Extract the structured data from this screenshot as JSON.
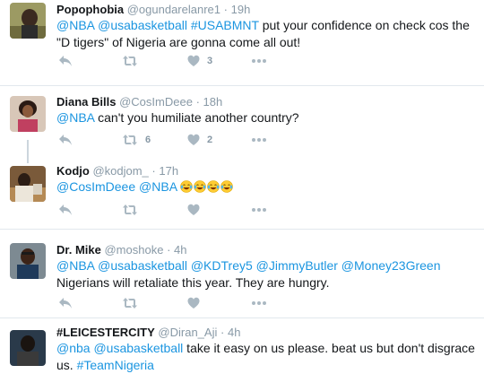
{
  "tweets": [
    {
      "name": "Popophobia",
      "handle": "@ogundarelanre1",
      "dot": "·",
      "time": "19h",
      "text_parts": [
        {
          "t": "@NBA",
          "link": true
        },
        {
          "t": " ",
          "link": false
        },
        {
          "t": "@usabasketball",
          "link": true
        },
        {
          "t": " ",
          "link": false
        },
        {
          "t": "#USABMNT",
          "link": true
        },
        {
          "t": " put your confidence on check cos the \"D tigers\" of Nigeria are gonna come all out!",
          "link": false
        }
      ],
      "actions": {
        "retweets": "",
        "likes": "3"
      }
    },
    {
      "name": "Diana Bills",
      "handle": "@CosImDeee",
      "dot": "·",
      "time": "18h",
      "text_parts": [
        {
          "t": "@NBA",
          "link": true
        },
        {
          "t": " can't you humiliate another country?",
          "link": false
        }
      ],
      "actions": {
        "retweets": "6",
        "likes": "2"
      }
    },
    {
      "name": "Kodjo",
      "handle": "@kodjom_",
      "dot": "·",
      "time": "17h",
      "text_parts": [
        {
          "t": "@CosImDeee",
          "link": true
        },
        {
          "t": " ",
          "link": false
        },
        {
          "t": "@NBA",
          "link": true
        },
        {
          "t": " ",
          "link": false
        }
      ],
      "emoji": [
        "face-with-tears-of-joy",
        "face-with-tears-of-joy",
        "face-with-tears-of-joy",
        "face-with-tears-of-joy"
      ],
      "actions": {
        "retweets": "",
        "likes": ""
      }
    },
    {
      "name": "Dr. Mike",
      "handle": "@moshoke",
      "dot": "·",
      "time": "4h",
      "text_parts": [
        {
          "t": "@NBA",
          "link": true
        },
        {
          "t": " ",
          "link": false
        },
        {
          "t": "@usabasketball",
          "link": true
        },
        {
          "t": " ",
          "link": false
        },
        {
          "t": "@KDTrey5",
          "link": true
        },
        {
          "t": " ",
          "link": false
        },
        {
          "t": "@JimmyButler",
          "link": true
        },
        {
          "t": " ",
          "link": false
        },
        {
          "t": "@Money23Green",
          "link": true
        },
        {
          "t": " Nigerians will retaliate this year. They are hungry.",
          "link": false
        }
      ],
      "actions": {
        "retweets": "",
        "likes": ""
      }
    },
    {
      "name": "#LEICESTERCITY",
      "handle": "@Diran_Aji",
      "dot": "·",
      "time": "4h",
      "text_parts": [
        {
          "t": "@nba",
          "link": true
        },
        {
          "t": " ",
          "link": false
        },
        {
          "t": "@usabasketball",
          "link": true
        },
        {
          "t": " take it easy on us please. beat us but don't disgrace us. ",
          "link": false
        },
        {
          "t": "#TeamNigeria",
          "link": true
        }
      ],
      "actions": {
        "retweets": "",
        "likes": ""
      }
    }
  ],
  "colors": {
    "link": "#1b95e0",
    "action_gray": "#aab8c2",
    "meta_gray": "#8899a6",
    "separator": "#e1e8ed"
  },
  "icons": [
    "reply-icon",
    "retweet-icon",
    "like-icon",
    "more-icon"
  ]
}
